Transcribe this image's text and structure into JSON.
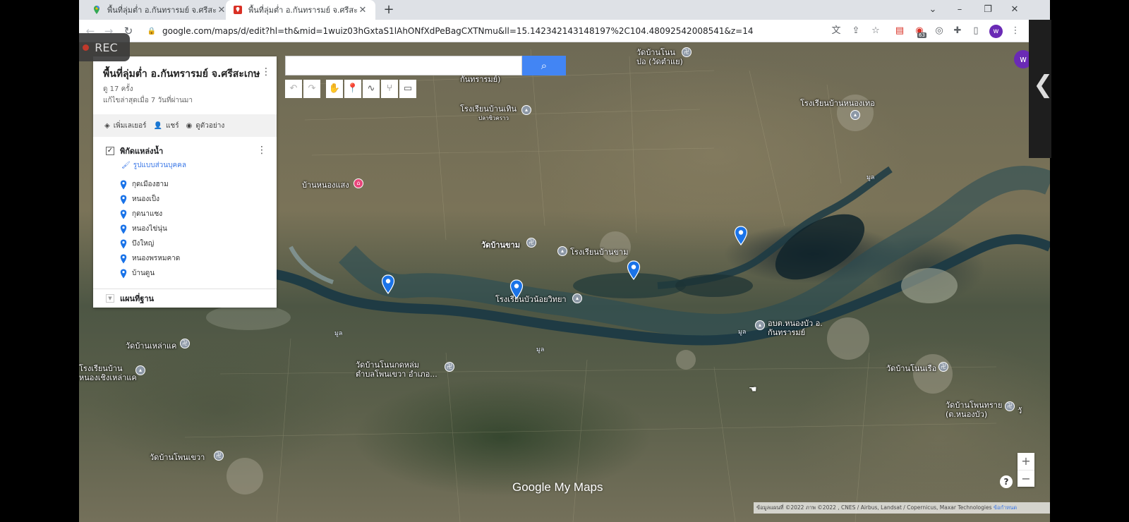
{
  "browser": {
    "tabs": [
      {
        "title": "พื้นที่ลุ่มต่ำ อ.กันทรารมย์ จ.ศรีสะเกษ -",
        "active": false,
        "favicon": "google-maps-icon"
      },
      {
        "title": "พื้นที่ลุ่มต่ำ อ.กันทรารมย์ จ.ศรีสะเกษ -",
        "active": true,
        "favicon": "my-maps-icon"
      }
    ],
    "url": "google.com/maps/d/edit?hl=th&mid=1wuiz03hGxtaS1lAhONfXdPeBagCXTNmu&ll=15.142342143148197%2C104.48092542008541&z=14",
    "extension_badge": "63",
    "profile_initial": "w"
  },
  "rec_badge": "REC",
  "search": {
    "placeholder": "",
    "button_icon": "search-icon"
  },
  "map_tools": [
    "undo-icon",
    "redo-icon",
    "hand-icon",
    "marker-icon",
    "line-icon",
    "route-icon",
    "ruler-icon"
  ],
  "panel": {
    "title": "พื้นที่ลุ่มต่ำ อ.กันทรารมย์ จ.ศรีสะเกษ",
    "views": "ดู 17 ครั้ง",
    "last_edited": "แก้ไขล่าสุดเมื่อ 7 วันที่ผ่านมา",
    "actions": {
      "add_layer": "เพิ่มเลเยอร์",
      "share": "แชร์",
      "preview": "ดูตัวอย่าง"
    },
    "layer": {
      "name": "พิกัดแหล่งน้ำ",
      "checked": true,
      "style_link": "รูปแบบส่วนบุคคล",
      "places": [
        "กุดเมืองฮาม",
        "หนองเป็ง",
        "กุดนาแซง",
        "หนองไข่นุ่น",
        "บึงใหญ่",
        "หนองพรหมคาด",
        "บ้านดูน"
      ]
    },
    "basemap": "แผนที่ฐาน"
  },
  "map_labels": {
    "wat_ban_non_po": "วัดบ้านโนน\nปอ (วัดตำแย)",
    "kantharom": "กันทรารมย์)",
    "school_ban_thin": "โรงเรียนบ้านเทิน",
    "school_ban_thin_sub": "ปลาซิวคราว",
    "school_nong_thoe": "โรงเรียนบ้านหนองเทอ",
    "ban_nong_saeng": "บ้านหนองแสง",
    "wat_ban_kham": "วัดบ้านขาม",
    "school_ban_kham": "โรงเรียนบ้านขาม",
    "school_bua_noi": "โรงเรียนบัวน้อยวิทยา",
    "obt_nong_bua": "อบต.หนองบัว อ.\nกันทรารมย์",
    "wat_lao_khae": "วัดบ้านเหล่าแค",
    "school_ban_nong_cheng": "โรงเรียนบ้าน\nหนองเชิงเหล่าแค",
    "wat_non_kotlam": "วัดบ้านโนนกดหล่ม\nตำบลโพนเขวา อำเภอ...",
    "wat_non_ruea": "วัดบ้านโนนเรือ",
    "wat_phon_sai": "วัดบ้านโพนทราย\n(ต.หนองบัว)",
    "wat_phon_khwao": "วัดบ้านโพนเขวา",
    "edge_sa": "วั",
    "mun": "มูล"
  },
  "google_logo": "Google My Maps",
  "attribution": "ข้อมูลแผนที่ ©2022 ภาพ ©2022 , CNES / Airbus, Landsat / Copernicus, Maxar Technologies",
  "attribution_link": "ข้อกำหนด",
  "zoom": {
    "in": "+",
    "out": "−"
  },
  "help": "?",
  "colors": {
    "accent": "#4285f4",
    "pin": "#1a73e8",
    "profile": "#6a2ab5",
    "poi_pink": "#e8457a"
  }
}
